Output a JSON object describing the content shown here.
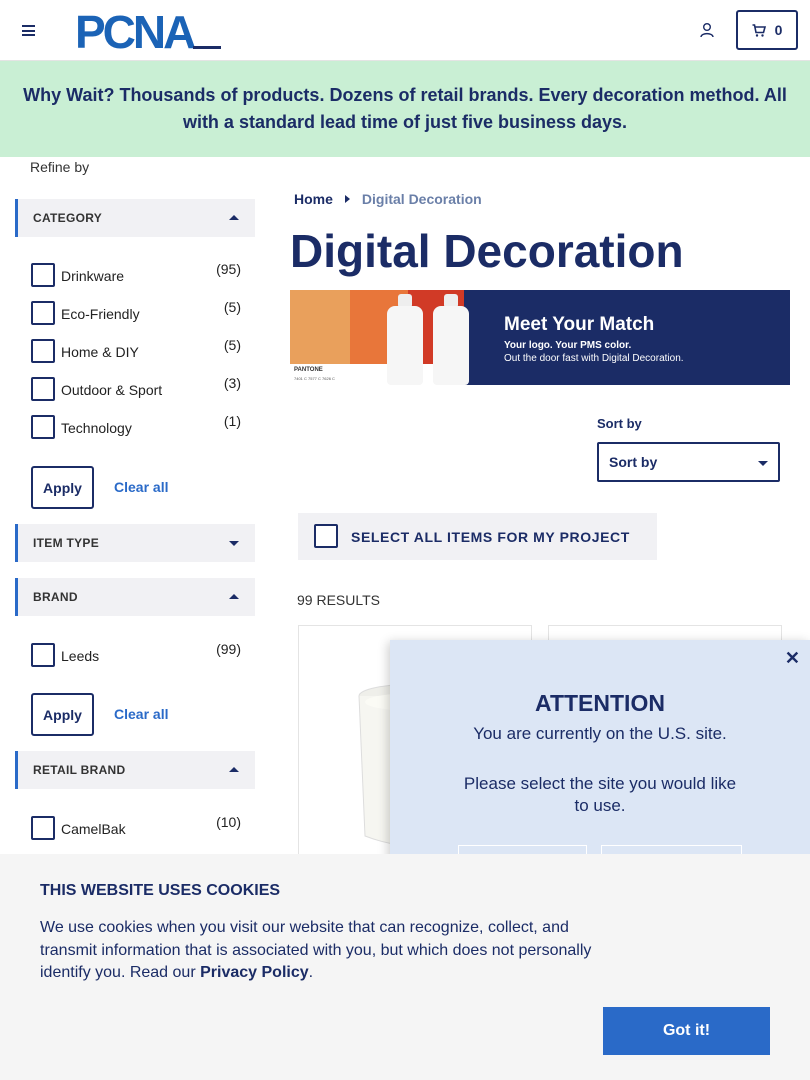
{
  "header": {
    "logo_text": "PCNA",
    "cart_count": "0"
  },
  "promo": {
    "text": "Why Wait? Thousands of products. Dozens of retail brands. Every decoration method. All with a standard lead time of just five business days."
  },
  "sidebar": {
    "refine_label": "Refine by",
    "category": {
      "title": "CATEGORY",
      "items": [
        {
          "label": "Drinkware",
          "count": "(95)"
        },
        {
          "label": "Eco-Friendly",
          "count": "(5)"
        },
        {
          "label": "Home & DIY",
          "count": "(5)"
        },
        {
          "label": "Outdoor & Sport",
          "count": "(3)"
        },
        {
          "label": "Technology",
          "count": "(1)"
        }
      ],
      "apply_label": "Apply",
      "clear_label": "Clear all"
    },
    "item_type": {
      "title": "ITEM TYPE"
    },
    "brand": {
      "title": "BRAND",
      "items": [
        {
          "label": "Leeds",
          "count": "(99)"
        }
      ],
      "apply_label": "Apply",
      "clear_label": "Clear all"
    },
    "retail_brand": {
      "title": "RETAIL BRAND",
      "items": [
        {
          "label": "CamelBak",
          "count": "(10)"
        }
      ]
    }
  },
  "breadcrumb": {
    "home": "Home",
    "current": "Digital Decoration"
  },
  "page_title": "Digital Decoration",
  "hero": {
    "title": "Meet Your Match",
    "line1": "Your logo. Your PMS color.",
    "line2": "Out the door fast with Digital Decoration.",
    "pantone_label": "PANTONE",
    "pantone_codes": "7401 C   7577 C   7626 C",
    "swatch_colors": [
      "#e9a05c",
      "#e8763a",
      "#d13a26"
    ]
  },
  "sort": {
    "label": "Sort by",
    "selected": "Sort by"
  },
  "select_all_label": "SELECT ALL ITEMS FOR MY PROJECT",
  "results_label": "99 RESULTS",
  "modal": {
    "close": "✕",
    "title": "ATTENTION",
    "text1": "You are currently on the U.S. site.",
    "text2": "Please select the site you would like to use."
  },
  "cookie": {
    "title": "THIS WEBSITE USES COOKIES",
    "text": "We use cookies when you visit our website that can recognize, collect, and transmit information that is associated with you, but which does not personally identify you. Read our",
    "link": "Privacy Policy",
    "period": ".",
    "button": "Got it!"
  },
  "colors": {
    "navy": "#1b2c66",
    "blue": "#2a6ac8",
    "promo_bg": "#c9efd4"
  }
}
